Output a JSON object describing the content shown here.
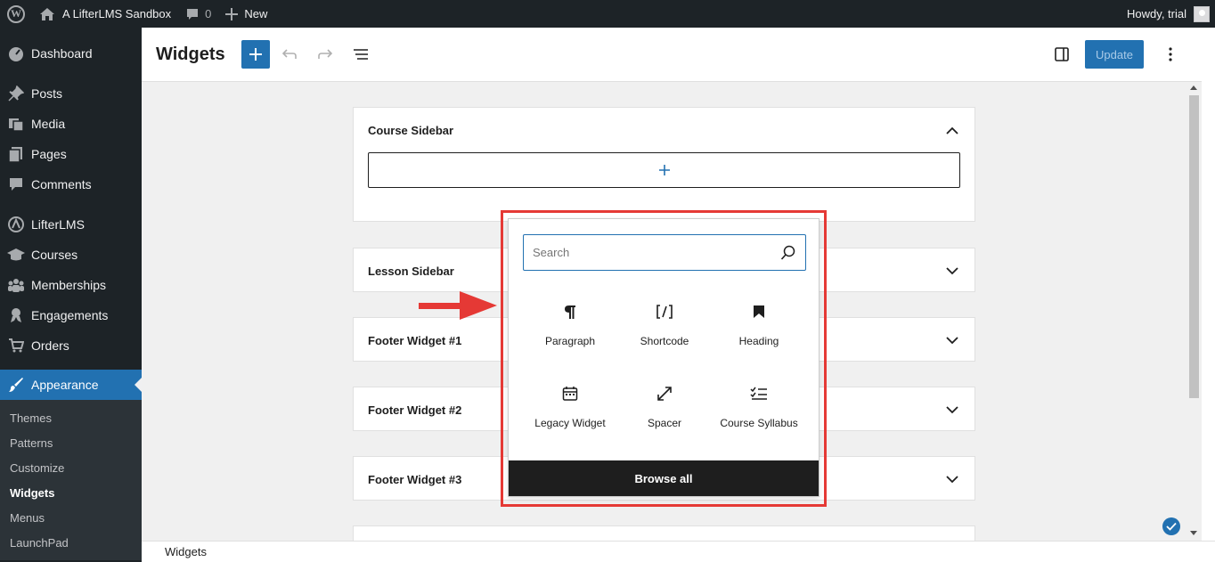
{
  "adminbar": {
    "site_name": "A LifterLMS Sandbox",
    "comments_count": "0",
    "new_label": "New",
    "howdy": "Howdy, trial"
  },
  "sidebar": {
    "items": [
      {
        "label": "Dashboard",
        "icon": "dashboard-icon"
      },
      {
        "label": "Posts",
        "icon": "pin-icon"
      },
      {
        "label": "Media",
        "icon": "media-icon"
      },
      {
        "label": "Pages",
        "icon": "pages-icon"
      },
      {
        "label": "Comments",
        "icon": "comment-icon"
      },
      {
        "label": "LifterLMS",
        "icon": "lifterlms-icon"
      },
      {
        "label": "Courses",
        "icon": "graduation-cap-icon"
      },
      {
        "label": "Memberships",
        "icon": "groups-icon"
      },
      {
        "label": "Engagements",
        "icon": "awards-icon"
      },
      {
        "label": "Orders",
        "icon": "cart-icon"
      },
      {
        "label": "Appearance",
        "icon": "brush-icon"
      }
    ],
    "submenu": [
      "Themes",
      "Patterns",
      "Customize",
      "Widgets",
      "Menus",
      "LaunchPad"
    ]
  },
  "header": {
    "title": "Widgets",
    "update_label": "Update"
  },
  "widget_areas": [
    {
      "title": "Course Sidebar",
      "expanded": true
    },
    {
      "title": "Lesson Sidebar",
      "expanded": false
    },
    {
      "title": "Footer Widget #1",
      "expanded": false
    },
    {
      "title": "Footer Widget #2",
      "expanded": false
    },
    {
      "title": "Footer Widget #3",
      "expanded": false
    }
  ],
  "inserter": {
    "search_placeholder": "Search",
    "blocks": [
      {
        "label": "Paragraph",
        "icon": "paragraph-icon"
      },
      {
        "label": "Shortcode",
        "icon": "shortcode-icon"
      },
      {
        "label": "Heading",
        "icon": "bookmark-icon"
      },
      {
        "label": "Legacy Widget",
        "icon": "calendar-icon"
      },
      {
        "label": "Spacer",
        "icon": "resize-icon"
      },
      {
        "label": "Course Syllabus",
        "icon": "checklist-icon"
      }
    ],
    "browse_all_label": "Browse all"
  },
  "footer": {
    "breadcrumb": "Widgets"
  },
  "colors": {
    "accent": "#2271b1",
    "adminbar_bg": "#1d2327",
    "highlight": "#e53935"
  }
}
